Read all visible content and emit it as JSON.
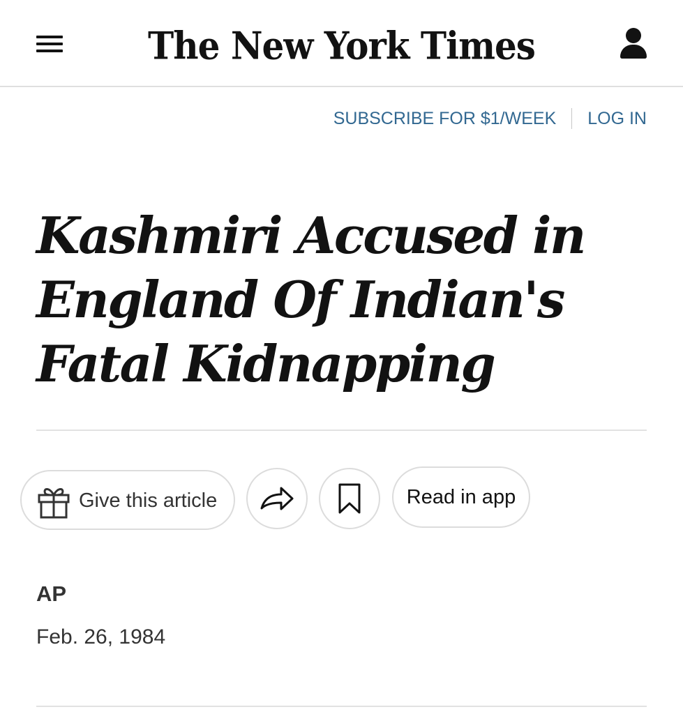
{
  "header": {
    "logo_text": "The New York Times",
    "menu_icon": "hamburger-menu-icon",
    "account_icon": "user-account-icon"
  },
  "subscribe_bar": {
    "subscribe_label": "SUBSCRIBE FOR $1/WEEK",
    "login_label": "LOG IN",
    "link_color": "#326891"
  },
  "article": {
    "headline": "Kashmiri Accused in England Of Indian's Fatal Kidnapping",
    "byline": "AP",
    "date": "Feb. 26, 1984"
  },
  "actions": {
    "gift_label": "Give this article",
    "gift_icon": "gift-icon",
    "share_icon": "share-icon",
    "save_icon": "bookmark-icon",
    "read_in_app_label": "Read in app"
  }
}
